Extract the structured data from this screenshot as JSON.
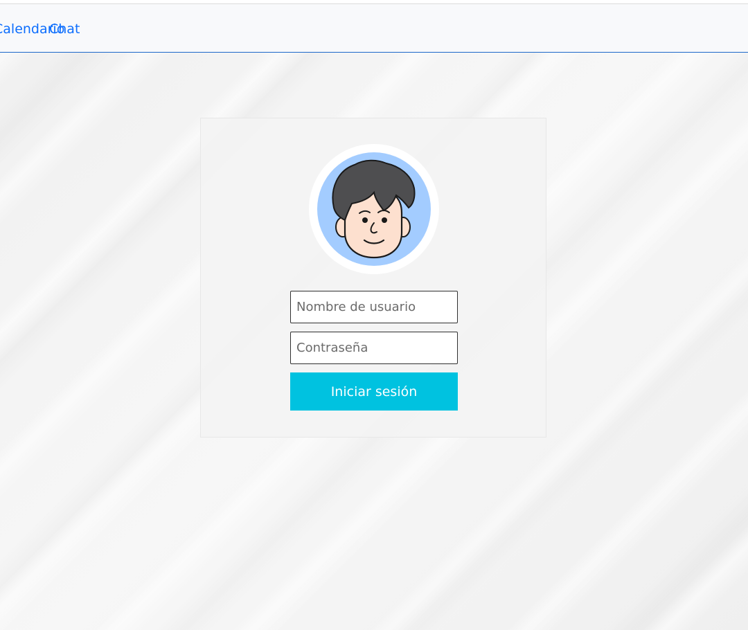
{
  "nav": {
    "links": [
      {
        "label": "Calendario"
      },
      {
        "label": "Chat"
      }
    ]
  },
  "login": {
    "username_placeholder": "Nombre de usuario",
    "password_placeholder": "Contraseña",
    "submit_label": "Iniciar sesión",
    "avatar_icon": "user-avatar-icon"
  },
  "colors": {
    "accent_link": "#0d6efd",
    "button": "#00c2e0",
    "avatar_bg": "#a3ccff",
    "hair": "#4e4e50",
    "skin": "#fde0cf"
  }
}
